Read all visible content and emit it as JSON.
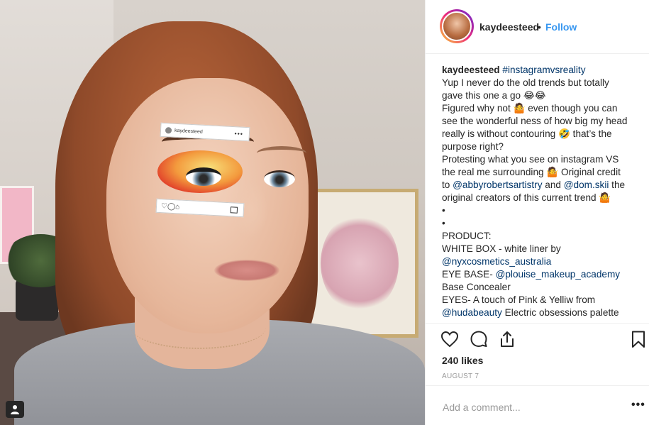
{
  "post": {
    "username": "kaydeesteed",
    "separator": "•",
    "follow_label": "Follow",
    "likes": "240 likes",
    "date": "AUGUST 7"
  },
  "photo_stickers": {
    "username": "kaydeesteed",
    "more": "•••",
    "icons": "♡◯⌂"
  },
  "caption": {
    "username": "kaydeesteed",
    "hashtag": "#instagramvsreality",
    "lines": {
      "l1": "Yup I never do the old trends but totally",
      "l2": "gave this one a go 😂😂",
      "l3": "Figured why not 🤷 even though you can",
      "l4": "see the wonderful ness of how big my head",
      "l5": "really is without contouring 🤣 that’s the",
      "l6": "purpose right?",
      "l7": "Protesting what you see on instagram VS",
      "l8": "the real me surrounding 🤷 Original credit",
      "l9_pre": "to ",
      "l9_link1": "@abbyrobertsartistry",
      "l9_mid": " and ",
      "l9_link2": "@dom.skii",
      "l9_post": " the",
      "l10": "original creators of this current trend 🤷",
      "bullet1": "•",
      "bullet2": "•",
      "l11": "PRODUCT:",
      "l12": "WHITE BOX - white liner by",
      "l13_link": "@nyxcosmetics_australia",
      "l14_pre": "EYE BASE- ",
      "l14_link": "@plouise_makeup_academy",
      "l15": "Base Concealer",
      "l16": "EYES- A touch of Pink & Yelliw from",
      "l17_link": "@hudabeauty",
      "l17_post": " Electric obsessions palette"
    }
  },
  "comment": {
    "placeholder": "Add a comment...",
    "more_label": "•••"
  },
  "colors": {
    "link": "#003569",
    "follow": "#3897f0",
    "text": "#262626",
    "muted": "#999999"
  }
}
